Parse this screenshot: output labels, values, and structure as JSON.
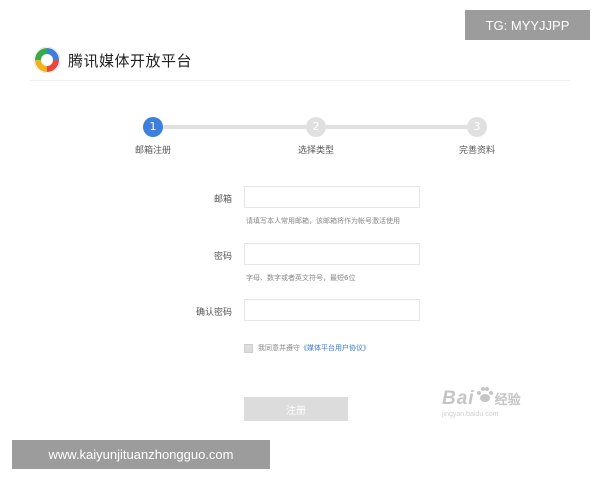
{
  "overlay": {
    "tg_text": "TG: MYYJJPP",
    "url_text": "www.kaiyunjituanzhongguo.com"
  },
  "header": {
    "brand": "腾讯媒体开放平台",
    "logo_icon": "tencent-media-logo"
  },
  "steps": [
    {
      "number": "1",
      "label": "邮箱注册",
      "active": true
    },
    {
      "number": "2",
      "label": "选择类型",
      "active": false
    },
    {
      "number": "3",
      "label": "完善资料",
      "active": false
    }
  ],
  "form": {
    "email": {
      "label": "邮箱",
      "value": "",
      "placeholder": "",
      "hint": "请填写本人常用邮箱，该邮箱将作为帐号激活使用"
    },
    "password": {
      "label": "密码",
      "value": "",
      "placeholder": "",
      "hint": "字母、数字或者英文符号，最短6位"
    },
    "confirm": {
      "label": "确认密码",
      "value": "",
      "placeholder": ""
    },
    "agreement": {
      "prefix": "我同意并遵守",
      "link": "《媒体平台用户协议》",
      "checked": false
    },
    "submit_label": "注册"
  },
  "watermark": {
    "logo_text": "Bai",
    "logo_suffix": "经验",
    "subtext": "jingyan.baidu.com"
  },
  "colors": {
    "accent": "#3d7fdc",
    "inactive": "#e0e0e0",
    "button": "#dcdcdc"
  }
}
